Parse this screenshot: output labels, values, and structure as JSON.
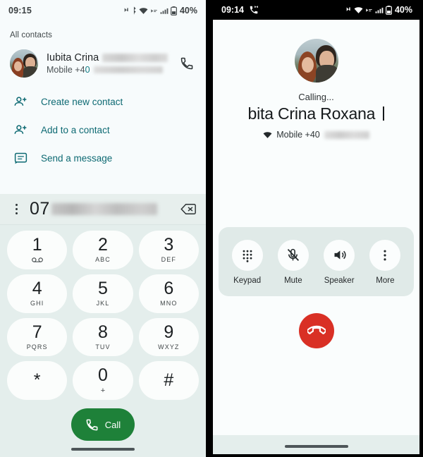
{
  "left_screen": {
    "status_bar": {
      "time": "09:15",
      "battery": "40%",
      "icons": [
        "nfc-icon",
        "bluetooth-icon",
        "wifi-icon",
        "vpn-icon",
        "signal-icon",
        "battery-icon"
      ]
    },
    "section_label": "All contacts",
    "contact": {
      "name": "Iubita Crina",
      "name_redacted": true,
      "mobile_prefix": "Mobile +4",
      "mobile_highlight": "0",
      "number_redacted": true,
      "call_icon": "phone-icon"
    },
    "actions": [
      {
        "label": "Create new contact",
        "icon": "person-add-icon"
      },
      {
        "label": "Add to a contact",
        "icon": "person-add-icon"
      },
      {
        "label": "Send a message",
        "icon": "message-icon"
      }
    ],
    "dialpad": {
      "overflow_icon": "kebab-menu-icon",
      "entered_number": "07",
      "number_redacted": true,
      "backspace_icon": "backspace-icon",
      "keys": [
        {
          "digit": "1",
          "letters": "",
          "sub_icon": "voicemail-icon"
        },
        {
          "digit": "2",
          "letters": "ABC"
        },
        {
          "digit": "3",
          "letters": "DEF"
        },
        {
          "digit": "4",
          "letters": "GHI"
        },
        {
          "digit": "5",
          "letters": "JKL"
        },
        {
          "digit": "6",
          "letters": "MNO"
        },
        {
          "digit": "7",
          "letters": "PQRS"
        },
        {
          "digit": "8",
          "letters": "TUV"
        },
        {
          "digit": "9",
          "letters": "WXYZ"
        },
        {
          "digit": "*",
          "letters": ""
        },
        {
          "digit": "0",
          "letters": "+"
        },
        {
          "digit": "#",
          "letters": ""
        }
      ],
      "call_button": {
        "label": "Call",
        "icon": "phone-icon",
        "color": "#1e8139"
      }
    }
  },
  "right_screen": {
    "status_bar": {
      "time": "09:14",
      "battery": "40%",
      "call_icon": "active-call-icon",
      "icons": [
        "nfc-icon",
        "wifi-icon",
        "vpn-icon",
        "signal-icon",
        "battery-icon"
      ]
    },
    "call": {
      "state": "Calling...",
      "callee_name": "bita Crina Roxana ",
      "line_icon": "sim-icon",
      "line_label": "Mobile +40",
      "number_redacted": true
    },
    "controls": [
      {
        "label": "Keypad",
        "icon": "dialpad-icon"
      },
      {
        "label": "Mute",
        "icon": "mic-off-icon"
      },
      {
        "label": "Speaker",
        "icon": "speaker-icon"
      },
      {
        "label": "More",
        "icon": "kebab-menu-icon"
      }
    ],
    "end_call": {
      "icon": "end-call-icon",
      "color": "#d93025"
    }
  }
}
